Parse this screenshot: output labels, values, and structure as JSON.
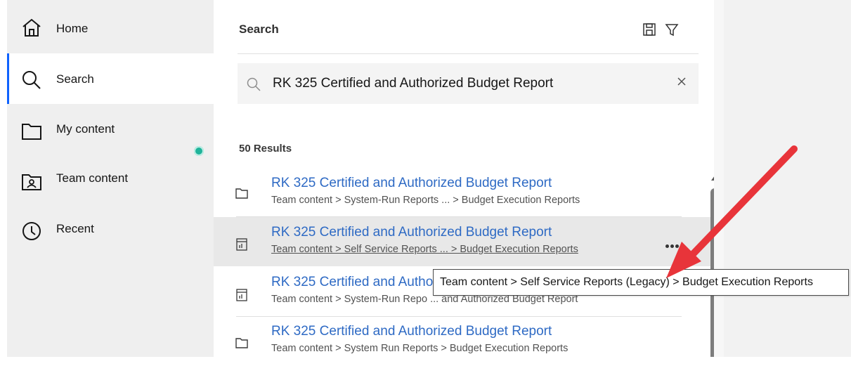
{
  "sidebar": {
    "items": [
      {
        "label": "Home",
        "icon": "home-icon"
      },
      {
        "label": "Search",
        "icon": "search-icon"
      },
      {
        "label": "My content",
        "icon": "folder-icon"
      },
      {
        "label": "Team content",
        "icon": "team-folder-icon"
      },
      {
        "label": "Recent",
        "icon": "clock-icon"
      }
    ],
    "active": "Search"
  },
  "panel": {
    "title": "Search",
    "header_icons": [
      "save-icon",
      "filter-icon"
    ]
  },
  "search": {
    "value": "RK 325 Certified and Authorized Budget Report",
    "placeholder": ""
  },
  "results": {
    "count_label": "50 Results",
    "items": [
      {
        "title": "RK 325 Certified and Authorized Budget Report",
        "path": "Team content > System-Run Reports ... > Budget Execution Reports",
        "icon": "folder-icon"
      },
      {
        "title": "RK 325 Certified and Authorized Budget Report",
        "path": "Team content > Self Service Reports ... > Budget Execution Reports",
        "icon": "report-icon"
      },
      {
        "title": "RK 325 Certified and Authorized Budget Report",
        "path": "Team content > System-Run Repo ... and Authorized Budget Report",
        "icon": "report-icon"
      },
      {
        "title": "RK 325 Certified and Authorized Budget Report",
        "path": "Team content > System Run Reports > Budget Execution Reports",
        "icon": "folder-icon"
      }
    ]
  },
  "tooltip": {
    "text": "Team content > Self Service Reports (Legacy) > Budget Execution Reports"
  },
  "colors": {
    "accent": "#0f62fe",
    "link": "#2e6ac4",
    "annotation_arrow": "#e8343a",
    "notification": "#1fb39a"
  }
}
